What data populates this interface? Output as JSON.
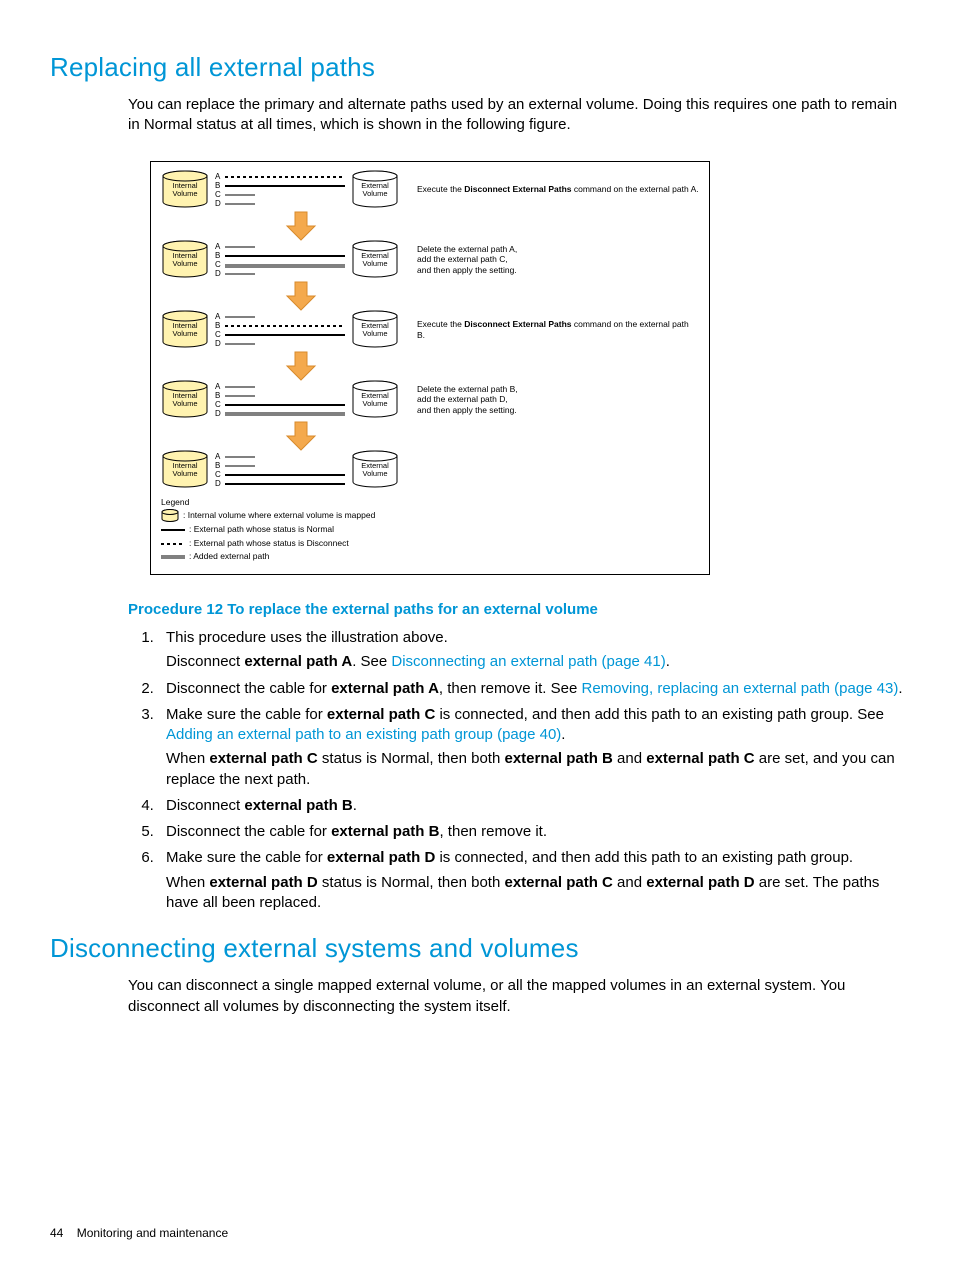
{
  "section1": {
    "heading": "Replacing all external paths",
    "intro": "You can replace the primary and alternate paths used by an external volume. Doing this requires one path to remain in Normal status at all times, which is shown in the following figure."
  },
  "figure": {
    "internal_label": "Internal\nVolume",
    "external_label": "External\nVolume",
    "paths": [
      "A",
      "B",
      "C",
      "D"
    ],
    "steps": [
      {
        "desc_pre": "Execute the ",
        "desc_bold": "Disconnect External Paths",
        "desc_post": " command on the external path A."
      },
      {
        "desc_full": "Delete the external path A,\nadd the external path C,\nand then apply the setting."
      },
      {
        "desc_pre": "Execute the ",
        "desc_bold": "Disconnect External Paths",
        "desc_post": " command on the external path B."
      },
      {
        "desc_full": "Delete the external path B,\nadd the external path D,\nand then apply the setting."
      },
      {
        "desc_full": ""
      }
    ],
    "legend_title": "Legend",
    "legend_items": [
      ": Internal volume where external volume is mapped",
      ": External path whose status is Normal",
      ": External path whose status is Disconnect",
      ": Added external path"
    ]
  },
  "procedure": {
    "title": "Procedure 12 To replace the external paths for an external volume",
    "steps": {
      "s1a": "This procedure uses the illustration above.",
      "s1b_pre": "Disconnect ",
      "s1b_bold": "external path A",
      "s1b_post": ". See ",
      "s1b_link": "Disconnecting an external path (page 41)",
      "s1b_end": ".",
      "s2_pre": "Disconnect the cable for ",
      "s2_bold": "external path A",
      "s2_post": ", then remove it. See ",
      "s2_link": "Removing, replacing an external path (page 43)",
      "s2_end": ".",
      "s3_pre": "Make sure the cable for ",
      "s3_bold": "external path C",
      "s3_post": " is connected, and then add this path to an existing path group. See ",
      "s3_link": "Adding an external path to an existing path group (page 40)",
      "s3_end": ".",
      "s3b_pre": "When ",
      "s3b_bold1": "external path C",
      "s3b_mid1": " status is Normal, then both ",
      "s3b_bold2": "external path B",
      "s3b_mid2": " and ",
      "s3b_bold3": "external path C",
      "s3b_post": " are set, and you can replace the next path.",
      "s4_pre": "Disconnect ",
      "s4_bold": "external path B",
      "s4_post": ".",
      "s5_pre": "Disconnect the cable for ",
      "s5_bold": "external path B",
      "s5_post": ", then remove it.",
      "s6_pre": "Make sure the cable for ",
      "s6_bold": "external path D",
      "s6_post": " is connected, and then add this path to an existing path group.",
      "s6b_pre": "When ",
      "s6b_bold1": "external path D",
      "s6b_mid1": " status is Normal, then both ",
      "s6b_bold2": "external path C",
      "s6b_mid2": " and ",
      "s6b_bold3": "external path D",
      "s6b_post": " are set. The paths have all been replaced."
    }
  },
  "section2": {
    "heading": "Disconnecting external systems and volumes",
    "intro": "You can disconnect a single mapped external volume, or all the mapped volumes in an external system. You disconnect all volumes by disconnecting the system itself."
  },
  "footer": {
    "page": "44",
    "title": "Monitoring and maintenance"
  }
}
